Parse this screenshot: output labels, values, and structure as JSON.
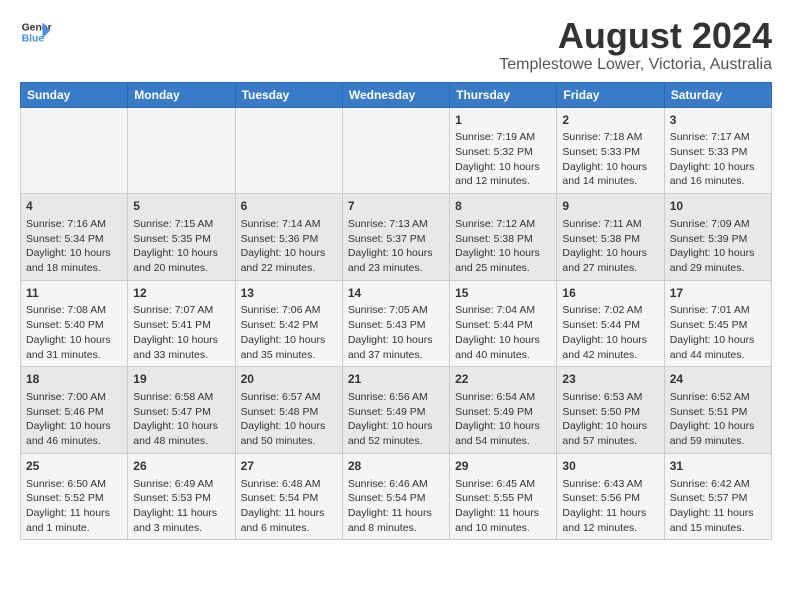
{
  "header": {
    "logo_line1": "General",
    "logo_line2": "Blue",
    "title": "August 2024",
    "subtitle": "Templestowe Lower, Victoria, Australia"
  },
  "calendar": {
    "days_of_week": [
      "Sunday",
      "Monday",
      "Tuesday",
      "Wednesday",
      "Thursday",
      "Friday",
      "Saturday"
    ],
    "weeks": [
      [
        {
          "day": "",
          "content": ""
        },
        {
          "day": "",
          "content": ""
        },
        {
          "day": "",
          "content": ""
        },
        {
          "day": "",
          "content": ""
        },
        {
          "day": "1",
          "content": "Sunrise: 7:19 AM\nSunset: 5:32 PM\nDaylight: 10 hours\nand 12 minutes."
        },
        {
          "day": "2",
          "content": "Sunrise: 7:18 AM\nSunset: 5:33 PM\nDaylight: 10 hours\nand 14 minutes."
        },
        {
          "day": "3",
          "content": "Sunrise: 7:17 AM\nSunset: 5:33 PM\nDaylight: 10 hours\nand 16 minutes."
        }
      ],
      [
        {
          "day": "4",
          "content": "Sunrise: 7:16 AM\nSunset: 5:34 PM\nDaylight: 10 hours\nand 18 minutes."
        },
        {
          "day": "5",
          "content": "Sunrise: 7:15 AM\nSunset: 5:35 PM\nDaylight: 10 hours\nand 20 minutes."
        },
        {
          "day": "6",
          "content": "Sunrise: 7:14 AM\nSunset: 5:36 PM\nDaylight: 10 hours\nand 22 minutes."
        },
        {
          "day": "7",
          "content": "Sunrise: 7:13 AM\nSunset: 5:37 PM\nDaylight: 10 hours\nand 23 minutes."
        },
        {
          "day": "8",
          "content": "Sunrise: 7:12 AM\nSunset: 5:38 PM\nDaylight: 10 hours\nand 25 minutes."
        },
        {
          "day": "9",
          "content": "Sunrise: 7:11 AM\nSunset: 5:38 PM\nDaylight: 10 hours\nand 27 minutes."
        },
        {
          "day": "10",
          "content": "Sunrise: 7:09 AM\nSunset: 5:39 PM\nDaylight: 10 hours\nand 29 minutes."
        }
      ],
      [
        {
          "day": "11",
          "content": "Sunrise: 7:08 AM\nSunset: 5:40 PM\nDaylight: 10 hours\nand 31 minutes."
        },
        {
          "day": "12",
          "content": "Sunrise: 7:07 AM\nSunset: 5:41 PM\nDaylight: 10 hours\nand 33 minutes."
        },
        {
          "day": "13",
          "content": "Sunrise: 7:06 AM\nSunset: 5:42 PM\nDaylight: 10 hours\nand 35 minutes."
        },
        {
          "day": "14",
          "content": "Sunrise: 7:05 AM\nSunset: 5:43 PM\nDaylight: 10 hours\nand 37 minutes."
        },
        {
          "day": "15",
          "content": "Sunrise: 7:04 AM\nSunset: 5:44 PM\nDaylight: 10 hours\nand 40 minutes."
        },
        {
          "day": "16",
          "content": "Sunrise: 7:02 AM\nSunset: 5:44 PM\nDaylight: 10 hours\nand 42 minutes."
        },
        {
          "day": "17",
          "content": "Sunrise: 7:01 AM\nSunset: 5:45 PM\nDaylight: 10 hours\nand 44 minutes."
        }
      ],
      [
        {
          "day": "18",
          "content": "Sunrise: 7:00 AM\nSunset: 5:46 PM\nDaylight: 10 hours\nand 46 minutes."
        },
        {
          "day": "19",
          "content": "Sunrise: 6:58 AM\nSunset: 5:47 PM\nDaylight: 10 hours\nand 48 minutes."
        },
        {
          "day": "20",
          "content": "Sunrise: 6:57 AM\nSunset: 5:48 PM\nDaylight: 10 hours\nand 50 minutes."
        },
        {
          "day": "21",
          "content": "Sunrise: 6:56 AM\nSunset: 5:49 PM\nDaylight: 10 hours\nand 52 minutes."
        },
        {
          "day": "22",
          "content": "Sunrise: 6:54 AM\nSunset: 5:49 PM\nDaylight: 10 hours\nand 54 minutes."
        },
        {
          "day": "23",
          "content": "Sunrise: 6:53 AM\nSunset: 5:50 PM\nDaylight: 10 hours\nand 57 minutes."
        },
        {
          "day": "24",
          "content": "Sunrise: 6:52 AM\nSunset: 5:51 PM\nDaylight: 10 hours\nand 59 minutes."
        }
      ],
      [
        {
          "day": "25",
          "content": "Sunrise: 6:50 AM\nSunset: 5:52 PM\nDaylight: 11 hours\nand 1 minute."
        },
        {
          "day": "26",
          "content": "Sunrise: 6:49 AM\nSunset: 5:53 PM\nDaylight: 11 hours\nand 3 minutes."
        },
        {
          "day": "27",
          "content": "Sunrise: 6:48 AM\nSunset: 5:54 PM\nDaylight: 11 hours\nand 6 minutes."
        },
        {
          "day": "28",
          "content": "Sunrise: 6:46 AM\nSunset: 5:54 PM\nDaylight: 11 hours\nand 8 minutes."
        },
        {
          "day": "29",
          "content": "Sunrise: 6:45 AM\nSunset: 5:55 PM\nDaylight: 11 hours\nand 10 minutes."
        },
        {
          "day": "30",
          "content": "Sunrise: 6:43 AM\nSunset: 5:56 PM\nDaylight: 11 hours\nand 12 minutes."
        },
        {
          "day": "31",
          "content": "Sunrise: 6:42 AM\nSunset: 5:57 PM\nDaylight: 11 hours\nand 15 minutes."
        }
      ]
    ]
  }
}
